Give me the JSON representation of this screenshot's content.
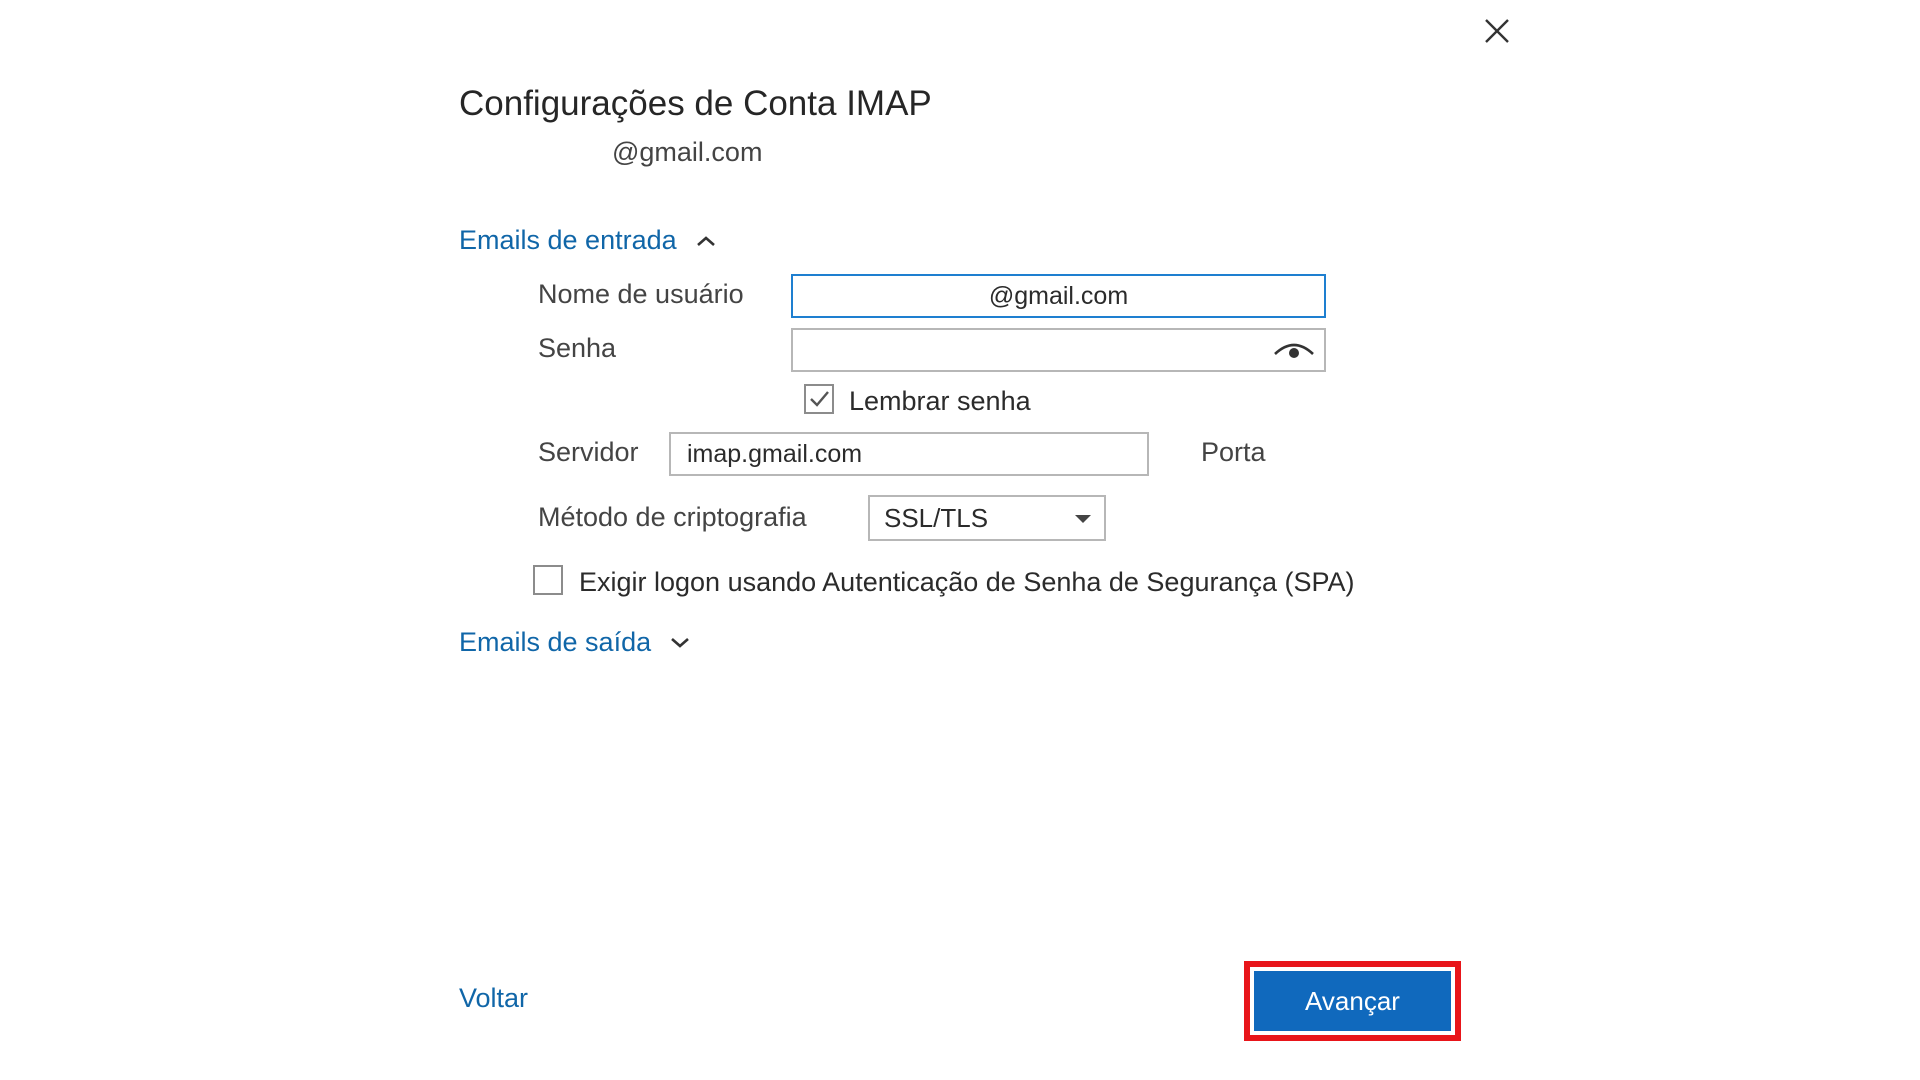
{
  "dialog": {
    "title": "Configurações de Conta IMAP",
    "account_email": "@gmail.com",
    "close_icon": "close-icon"
  },
  "incoming": {
    "section_label": "Emails de entrada",
    "expanded": true,
    "username_label": "Nome de usuário",
    "username_value": "@gmail.com",
    "password_label": "Senha",
    "password_value": "",
    "show_password_icon": "eye-icon",
    "remember_password_label": "Lembrar senha",
    "remember_password_checked": true,
    "server_label": "Servidor",
    "server_value": "imap.gmail.com",
    "port_label": "Porta",
    "encryption_label": "Método de criptografia",
    "encryption_value": "SSL/TLS",
    "spa_label": "Exigir logon usando Autenticação de Senha de Segurança (SPA)",
    "spa_checked": false
  },
  "outgoing": {
    "section_label": "Emails de saída",
    "expanded": false
  },
  "footer": {
    "back_label": "Voltar",
    "next_label": "Avançar"
  },
  "colors": {
    "accent": "#1069bd",
    "link": "#1066a8",
    "focus_border": "#1e7fd0",
    "highlight": "#e8151a"
  }
}
